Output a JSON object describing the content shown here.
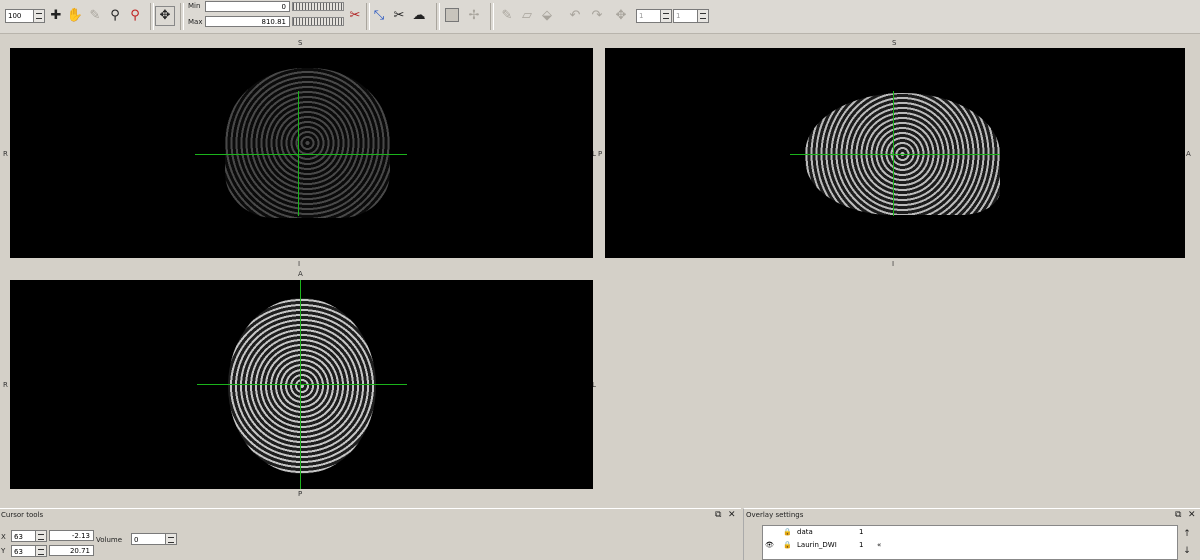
{
  "toolbar": {
    "zoom_value": "100",
    "min_label": "Min",
    "min_value": "0",
    "max_label": "Max",
    "max_value": "810.81",
    "volume_spin_1": "1",
    "volume_spin_2": "1"
  },
  "views": {
    "coronal": {
      "top": "S",
      "bottom": "I",
      "left": "R",
      "right": "L"
    },
    "sagittal": {
      "top": "S",
      "bottom": "I",
      "left": "P",
      "right": "A"
    },
    "axial": {
      "top": "A",
      "bottom": "P",
      "left": "R",
      "right": "L"
    }
  },
  "cursor_tools": {
    "title": "Cursor tools",
    "x_label": "X",
    "x_voxel": "63",
    "x_world": "-2.13",
    "y_label": "Y",
    "y_voxel": "63",
    "y_world": "20.71",
    "volume_label": "Volume",
    "volume_value": "0"
  },
  "overlay_settings": {
    "title": "Overlay settings",
    "rows": [
      {
        "name": "data",
        "value": "1"
      },
      {
        "name": "Laurin_DWI",
        "value": "1"
      }
    ]
  },
  "colors": {
    "crosshair": "#1bb31b",
    "background": "#d4d0c8"
  }
}
